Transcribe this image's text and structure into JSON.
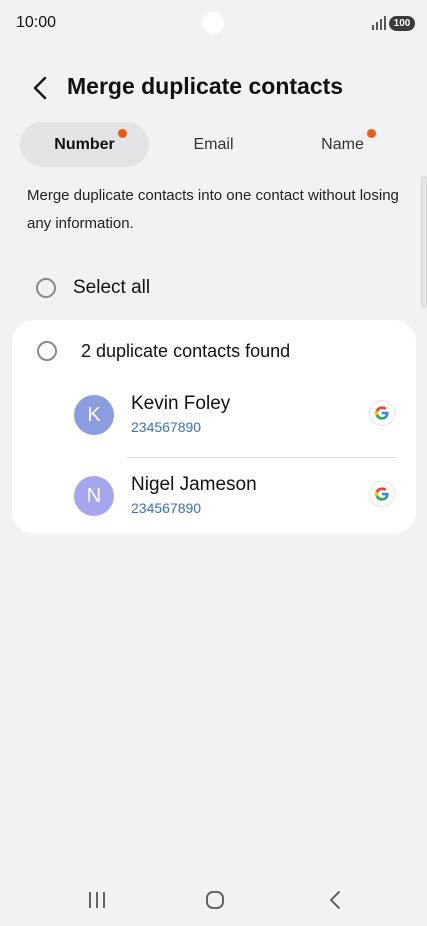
{
  "status_bar": {
    "time": "10:00",
    "battery": "100"
  },
  "header": {
    "title": "Merge duplicate contacts"
  },
  "tabs": [
    {
      "label": "Number",
      "active": true,
      "dot": true
    },
    {
      "label": "Email",
      "active": false,
      "dot": false
    },
    {
      "label": "Name",
      "active": false,
      "dot": true
    }
  ],
  "description": "Merge duplicate contacts into one contact without losing any information.",
  "select_all": {
    "label": "Select all"
  },
  "group": {
    "title": "2 duplicate contacts found",
    "contacts": [
      {
        "initial": "K",
        "name": "Kevin Foley",
        "number": "234567890",
        "avatar_color": "#8c9ce0",
        "account_icon": "google-icon"
      },
      {
        "initial": "N",
        "name": "Nigel Jameson",
        "number": "234567890",
        "avatar_color": "#a6a6ee",
        "account_icon": "google-icon"
      }
    ]
  },
  "colors": {
    "accent_dot": "#ec5a1a",
    "link": "#3a6fc1",
    "background": "#f2f2f5"
  },
  "nav_bar": {
    "icons": [
      "recent-apps-icon",
      "home-icon",
      "back-icon"
    ]
  }
}
